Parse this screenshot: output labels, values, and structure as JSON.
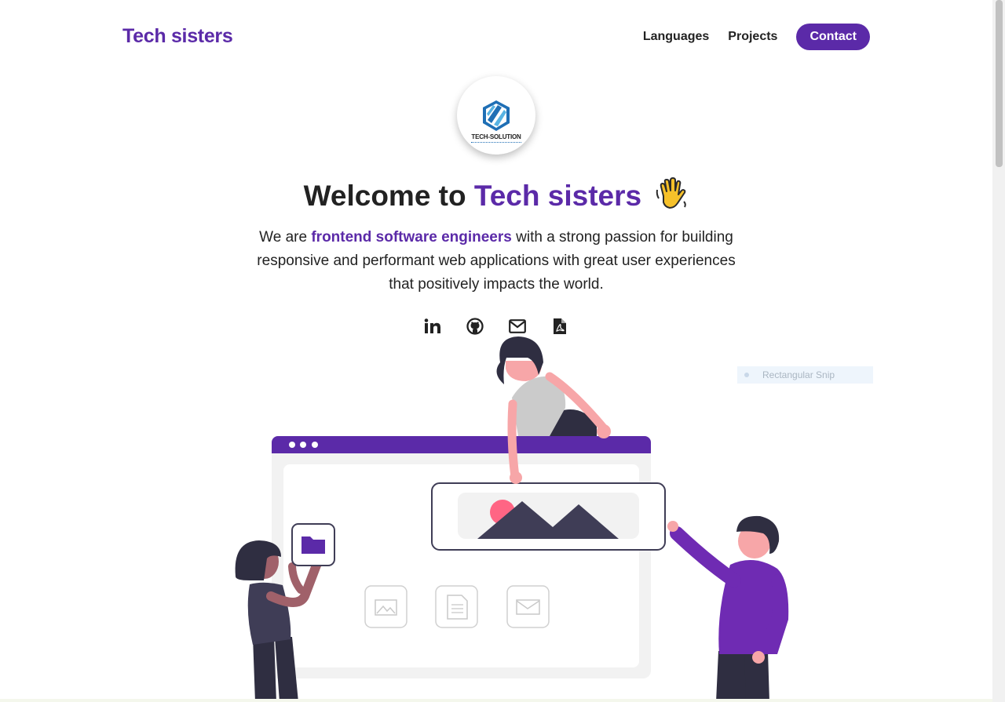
{
  "header": {
    "brand": "Tech sisters",
    "nav": {
      "languages": "Languages",
      "projects": "Projects",
      "contact": "Contact"
    }
  },
  "logo": {
    "text": "TECH-SOLUTION",
    "icon": "hexagon-logo-icon"
  },
  "hero": {
    "title_prefix": "Welcome to ",
    "title_accent": "Tech sisters",
    "wave_icon": "waving-hand-icon",
    "intro_pre": "We are ",
    "intro_accent": "frontend software engineers",
    "intro_post": " with a strong passion for building responsive and performant web applications with great user experiences that positively impacts the world."
  },
  "socials": [
    {
      "icon": "linkedin-icon"
    },
    {
      "icon": "github-icon"
    },
    {
      "icon": "email-icon"
    },
    {
      "icon": "pdf-icon"
    }
  ],
  "overlay": {
    "snip_label": "Rectangular Snip"
  },
  "colors": {
    "accent": "#5b2aa8",
    "text": "#222222",
    "panel": "#f2f2f2",
    "pink": "#f7a6a8"
  }
}
